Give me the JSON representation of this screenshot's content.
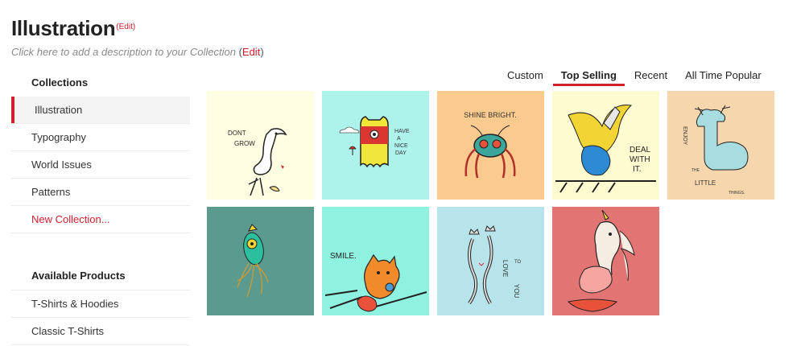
{
  "header": {
    "title": "Illustration",
    "title_edit": "(Edit)",
    "description": "Click here to add a description to your Collection",
    "desc_edit_open": "(",
    "desc_edit_link": "Edit",
    "desc_edit_close": ")"
  },
  "sidebar": {
    "collections_heading": "Collections",
    "collections": [
      {
        "label": "Illustration"
      },
      {
        "label": "Typography"
      },
      {
        "label": "World Issues"
      },
      {
        "label": "Patterns"
      }
    ],
    "new_collection": "New Collection...",
    "products_heading": "Available Products",
    "products": [
      {
        "label": "T-Shirts & Hoodies"
      },
      {
        "label": "Classic T-Shirts"
      }
    ]
  },
  "tabs": [
    {
      "label": "Custom"
    },
    {
      "label": "Top Selling"
    },
    {
      "label": "Recent"
    },
    {
      "label": "All Time Popular"
    }
  ],
  "active_tab": "Top Selling",
  "artworks": [
    {
      "bg": "#fefee3",
      "text": [
        "DONT",
        "GROW"
      ]
    },
    {
      "bg": "#aef2ec",
      "text": [
        "HAVE",
        "A",
        "NICE",
        "DAY"
      ]
    },
    {
      "bg": "#fbca8e",
      "text": [
        "SHINE BRIGHT."
      ]
    },
    {
      "bg": "#fdfbcf",
      "text": [
        "DEAL",
        "WITH",
        "IT."
      ]
    },
    {
      "bg": "#f6d6ad",
      "text": [
        "ENJOY",
        "THE",
        "LITTLE",
        "THINGS."
      ]
    },
    {
      "bg": "#5b9b8f",
      "text": []
    },
    {
      "bg": "#8ff2e0",
      "text": [
        "SMILE."
      ]
    },
    {
      "bg": "#b7e3ea",
      "text": [
        "LOVE",
        "TO",
        "YOU"
      ]
    },
    {
      "bg": "#e27474",
      "text": []
    }
  ],
  "colors": {
    "accent": "#d0202e"
  }
}
